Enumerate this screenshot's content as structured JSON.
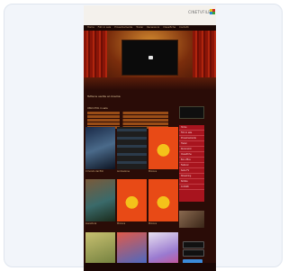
{
  "site": {
    "logo_text": "CINETVFILE",
    "nav": [
      "Home",
      "Film in sala",
      "Prossimamente",
      "Trailer",
      "Recensioni",
      "Classifiche",
      "Contatti"
    ],
    "headline": "Tutte le uscite al cinema",
    "section_title": "Ultimi film in sala",
    "sidebar_items": [
      "Home",
      "Film in sala",
      "Prossimamente",
      "Trailer",
      "Recensioni",
      "Classifiche",
      "Box office",
      "Festival",
      "Serie TV",
      "Streaming",
      "Notizie",
      "Contatti"
    ],
    "posters": [
      {
        "caption": "Il mondo dei film"
      },
      {
        "caption": "Animazione"
      },
      {
        "caption": "Minions"
      },
      {
        "caption": "Avventura"
      },
      {
        "caption": "Minions"
      },
      {
        "caption": "Minions"
      },
      {
        "caption": ""
      },
      {
        "caption": ""
      },
      {
        "caption": ""
      }
    ]
  }
}
